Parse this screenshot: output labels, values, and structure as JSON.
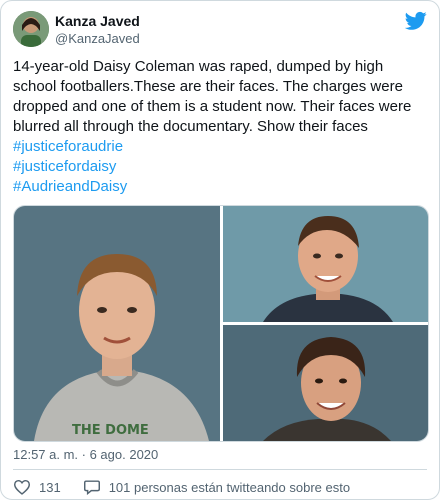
{
  "tweet": {
    "display_name": "Kanza Javed",
    "handle": "@KanzaJaved",
    "text": "14-year-old Daisy Coleman was raped, dumped by high school footballers.These are their faces. The charges were dropped and one of them is a student now. Their faces were blurred all through the documentary. Show their faces",
    "hashtags": [
      "#justiceforaudrie",
      "#justicefordaisy",
      "#AudrieandDaisy"
    ],
    "photo_shirt_text": "THE DOME",
    "timestamp": "12:57 a. m. · 6 ago. 2020",
    "likes": "131",
    "talking": "101 personas están twitteando sobre esto"
  },
  "colors": {
    "accent": "#1d9bf0",
    "muted": "#536471",
    "border": "#cfd9de",
    "like": "#536471"
  },
  "icons": [
    "twitter-bird-icon",
    "heart-icon",
    "speech-bubble-icon"
  ]
}
